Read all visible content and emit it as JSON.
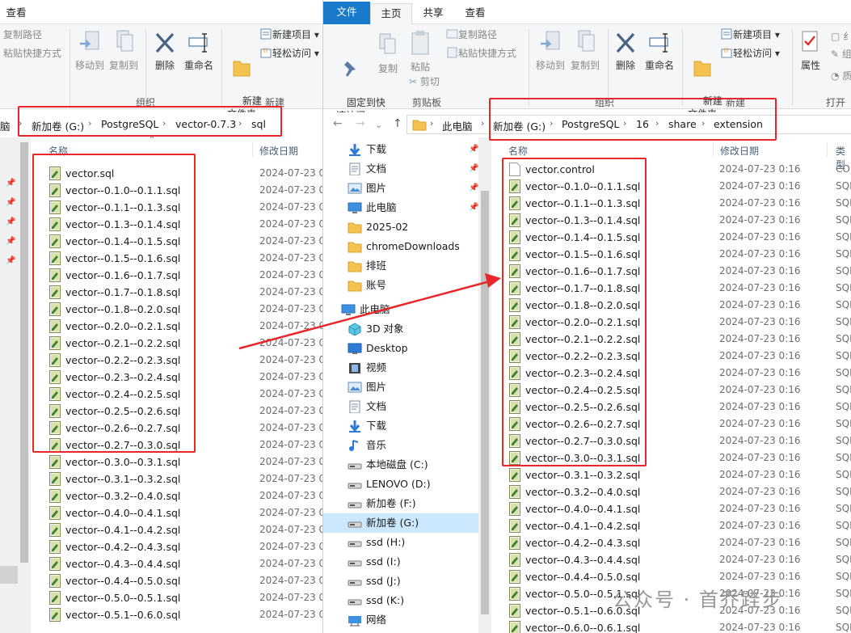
{
  "left": {
    "tab_view": "查看",
    "ribbon": {
      "copy_path": "复制路径",
      "paste_shortcut": "粘贴快捷方式",
      "move_to": "移动到",
      "copy_to": "复制到",
      "delete": "删除",
      "rename": "重命名",
      "new_folder": "新建\n文件夹",
      "new_item": "新建项目",
      "easy_access": "轻松访问",
      "group_organize": "组织",
      "group_new": "新建"
    },
    "breadcrumb": [
      "脑",
      "新加卷 (G:)",
      "PostgreSQL",
      "vector-0.7.3",
      "sql"
    ],
    "col_name": "名称",
    "col_date": "修改日期",
    "date": "2024-07-23 0",
    "files": [
      "vector.sql",
      "vector--0.1.0--0.1.1.sql",
      "vector--0.1.1--0.1.3.sql",
      "vector--0.1.3--0.1.4.sql",
      "vector--0.1.4--0.1.5.sql",
      "vector--0.1.5--0.1.6.sql",
      "vector--0.1.6--0.1.7.sql",
      "vector--0.1.7--0.1.8.sql",
      "vector--0.1.8--0.2.0.sql",
      "vector--0.2.0--0.2.1.sql",
      "vector--0.2.1--0.2.2.sql",
      "vector--0.2.2--0.2.3.sql",
      "vector--0.2.3--0.2.4.sql",
      "vector--0.2.4--0.2.5.sql",
      "vector--0.2.5--0.2.6.sql",
      "vector--0.2.6--0.2.7.sql",
      "vector--0.2.7--0.3.0.sql",
      "vector--0.3.0--0.3.1.sql",
      "vector--0.3.1--0.3.2.sql",
      "vector--0.3.2--0.4.0.sql",
      "vector--0.4.0--0.4.1.sql",
      "vector--0.4.1--0.4.2.sql",
      "vector--0.4.2--0.4.3.sql",
      "vector--0.4.3--0.4.4.sql",
      "vector--0.4.4--0.5.0.sql",
      "vector--0.5.0--0.5.1.sql",
      "vector--0.5.1--0.6.0.sql"
    ]
  },
  "right": {
    "tabs": [
      "文件",
      "主页",
      "共享",
      "查看"
    ],
    "ribbon": {
      "pin": "固定到快\n速访问",
      "copy": "复制",
      "paste": "粘贴",
      "copy_path": "复制路径",
      "paste_shortcut": "粘贴快捷方式",
      "cut": "剪切",
      "move_to": "移动到",
      "copy_to": "复制到",
      "delete": "删除",
      "rename": "重命名",
      "new_folder": "新建\n文件夹",
      "new_item": "新建项目",
      "easy_access": "轻松访问",
      "properties": "属性",
      "group_clipboard": "剪贴板",
      "group_organize": "组织",
      "group_new": "新建",
      "group_open": "打开"
    },
    "breadcrumb": [
      "此电脑",
      "新加卷 (G:)",
      "PostgreSQL",
      "16",
      "share",
      "extension"
    ],
    "nav_items": [
      {
        "label": "下载",
        "icon": "download-arrow-icon",
        "pinned": true
      },
      {
        "label": "文档",
        "icon": "document-icon",
        "pinned": true
      },
      {
        "label": "图片",
        "icon": "picture-icon",
        "pinned": true
      },
      {
        "label": "此电脑",
        "icon": "computer-icon",
        "pinned": true
      },
      {
        "label": "2025-02",
        "icon": "folder-icon"
      },
      {
        "label": "chromeDownloads",
        "icon": "folder-icon"
      },
      {
        "label": "排班",
        "icon": "folder-icon"
      },
      {
        "label": "账号",
        "icon": "folder-icon"
      },
      {
        "label": "此电脑",
        "icon": "computer-icon"
      },
      {
        "label": "3D 对象",
        "icon": "cube-icon"
      },
      {
        "label": "Desktop",
        "icon": "desktop-icon"
      },
      {
        "label": "视频",
        "icon": "video-icon"
      },
      {
        "label": "图片",
        "icon": "picture-icon"
      },
      {
        "label": "文档",
        "icon": "document-icon"
      },
      {
        "label": "下载",
        "icon": "download-arrow-icon"
      },
      {
        "label": "音乐",
        "icon": "music-icon"
      },
      {
        "label": "本地磁盘 (C:)",
        "icon": "drive-icon"
      },
      {
        "label": "LENOVO (D:)",
        "icon": "drive-icon"
      },
      {
        "label": "新加卷 (F:)",
        "icon": "drive-icon"
      },
      {
        "label": "新加卷 (G:)",
        "icon": "drive-icon",
        "selected": true
      },
      {
        "label": "ssd (H:)",
        "icon": "drive-icon"
      },
      {
        "label": "ssd (I:)",
        "icon": "drive-icon"
      },
      {
        "label": "ssd (J:)",
        "icon": "drive-icon"
      },
      {
        "label": "ssd (K:)",
        "icon": "drive-icon"
      },
      {
        "label": "网络",
        "icon": "network-icon"
      }
    ],
    "col_name": "名称",
    "col_date": "修改日期",
    "col_type": "类型",
    "date": "2024-07-23 0:16",
    "type_control": "CO",
    "type_sql": "SQL",
    "files": [
      "vector.control",
      "vector--0.1.0--0.1.1.sql",
      "vector--0.1.1--0.1.3.sql",
      "vector--0.1.3--0.1.4.sql",
      "vector--0.1.4--0.1.5.sql",
      "vector--0.1.5--0.1.6.sql",
      "vector--0.1.6--0.1.7.sql",
      "vector--0.1.7--0.1.8.sql",
      "vector--0.1.8--0.2.0.sql",
      "vector--0.2.0--0.2.1.sql",
      "vector--0.2.1--0.2.2.sql",
      "vector--0.2.2--0.2.3.sql",
      "vector--0.2.3--0.2.4.sql",
      "vector--0.2.4--0.2.5.sql",
      "vector--0.2.5--0.2.6.sql",
      "vector--0.2.6--0.2.7.sql",
      "vector--0.2.7--0.3.0.sql",
      "vector--0.3.0--0.3.1.sql",
      "vector--0.3.1--0.3.2.sql",
      "vector--0.3.2--0.4.0.sql",
      "vector--0.4.0--0.4.1.sql",
      "vector--0.4.1--0.4.2.sql",
      "vector--0.4.2--0.4.3.sql",
      "vector--0.4.3--0.4.4.sql",
      "vector--0.4.4--0.5.0.sql",
      "vector--0.5.0--0.5.1.sql",
      "vector--0.5.1--0.6.0.sql",
      "vector--0.6.0--0.6.1.sql"
    ]
  },
  "watermark": "公众号 · 首乔跬步",
  "colors": {
    "annotation": "#e8262b",
    "file_tab": "#1979ca",
    "selected": "#cce8ff"
  }
}
